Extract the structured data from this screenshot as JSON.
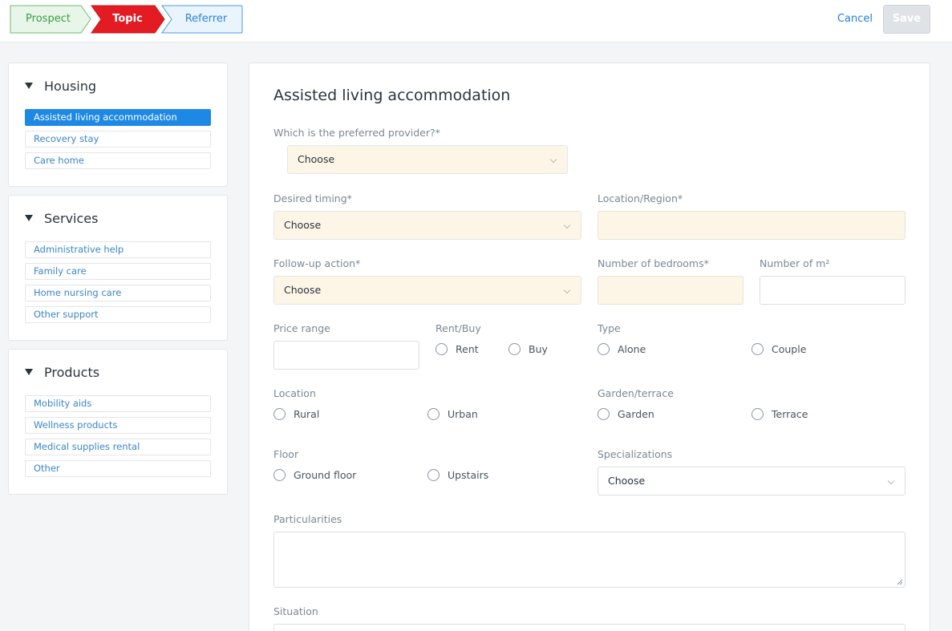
{
  "steps": {
    "prospect": "Prospect",
    "topic": "Topic",
    "referrer": "Referrer"
  },
  "header": {
    "cancel": "Cancel",
    "save": "Save"
  },
  "sidebar": {
    "housing": {
      "title": "Housing",
      "items": [
        "Assisted living accommodation",
        "Recovery stay",
        "Care home"
      ]
    },
    "services": {
      "title": "Services",
      "items": [
        "Administrative help",
        "Family care",
        "Home nursing care",
        "Other support"
      ]
    },
    "products": {
      "title": "Products",
      "items": [
        "Mobility aids",
        "Wellness products",
        "Medical supplies rental",
        "Other"
      ]
    }
  },
  "form": {
    "title": "Assisted living accommodation",
    "provider": {
      "label": "Which is the preferred provider?*",
      "value": "Choose"
    },
    "timing": {
      "label": "Desired timing*",
      "value": "Choose"
    },
    "region": {
      "label": "Location/Region*"
    },
    "followup": {
      "label": "Follow-up action*",
      "value": "Choose"
    },
    "bedrooms": {
      "label": "Number of bedrooms*"
    },
    "m2": {
      "label": "Number of m²"
    },
    "price": {
      "label": "Price range"
    },
    "rentbuy": {
      "label": "Rent/Buy",
      "options": [
        "Rent",
        "Buy"
      ]
    },
    "type": {
      "label": "Type",
      "options": [
        "Alone",
        "Couple"
      ]
    },
    "location": {
      "label": "Location",
      "options": [
        "Rural",
        "Urban"
      ]
    },
    "garden": {
      "label": "Garden/terrace",
      "options": [
        "Garden",
        "Terrace"
      ]
    },
    "floor": {
      "label": "Floor",
      "options": [
        "Ground floor",
        "Upstairs"
      ]
    },
    "specializations": {
      "label": "Specializations",
      "value": "Choose"
    },
    "particularities": {
      "label": "Particularities"
    },
    "situation": {
      "label": "Situation"
    }
  },
  "colors": {
    "prospect": "#e8f5e9",
    "topic": "#e31b23",
    "referrer": "#eaf4fd",
    "active_item": "#1e88e5",
    "required_field": "#fdf6e6"
  }
}
